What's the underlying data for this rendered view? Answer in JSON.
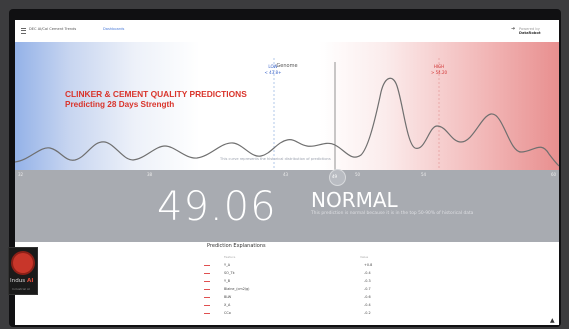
{
  "header": {
    "app_title": "DEC AI/Cal Cement Trends",
    "nav_link": "Dashboards",
    "share_icon": "share-icon",
    "powered_prefix": "Powered by",
    "brand": "DataRobot"
  },
  "chart": {
    "heading_line1": "CLINKER & CEMENT QUALITY PREDICTIONS",
    "heading_line2": "Predicting 28 Days Strength",
    "caption": "This curve represents the historical distribution of predictions",
    "markers": {
      "low": {
        "label": "LOW",
        "value": "< 43.8+"
      },
      "center": {
        "label": "Genome"
      },
      "high": {
        "label": "HIGH",
        "value": "> 54.20"
      }
    },
    "ticks": [
      "32",
      "38",
      "43",
      "50",
      "54",
      "60"
    ],
    "heading_color": "#d9342b",
    "low_color": "#94b2e8",
    "high_color": "#e88f8f"
  },
  "result": {
    "value": "49.06",
    "status": "NORMAL",
    "description": "This prediction is normal because it is in the top 50-90% of historical data",
    "marker_label": "49"
  },
  "explanations": {
    "title": "Prediction Explanations",
    "col_feature": "Feature",
    "col_value": "Value",
    "rows": [
      {
        "feature": "Y_A",
        "impact": "+0.8"
      },
      {
        "feature": "SO_Tk",
        "impact": "-0.4"
      },
      {
        "feature": "Y_B",
        "impact": "-0.3"
      },
      {
        "feature": "Blaine_(cm2/g)",
        "impact": "-0.7"
      },
      {
        "feature": "BLW",
        "impact": "-0.6"
      },
      {
        "feature": "X_A",
        "impact": "-0.4"
      },
      {
        "feature": "CCo",
        "impact": "-0.2"
      }
    ]
  },
  "logo": {
    "name_left": "Indus",
    "name_right": "AI",
    "sub": "Industrial AI"
  },
  "help_icon": "hat-icon"
}
